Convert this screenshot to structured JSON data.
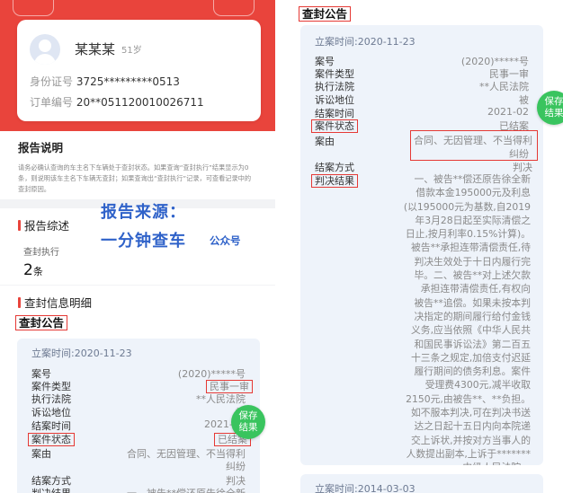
{
  "profile": {
    "name": "某某某",
    "age": "51岁",
    "id_label": "身份证号",
    "id_value": "3725*********0513",
    "order_label": "订单编号",
    "order_value": "20**051120010026711"
  },
  "explain": {
    "title": "报告说明",
    "text": "请务必确认查询的车主名下车辆处于查封状态。如果查询“查封执行”结果显示为0条，则说明该车主名下车辆无查封；如果查询出“查封执行”记录，可查看记录中的查封原因。"
  },
  "promo": {
    "line1": "报告来源：",
    "line2": "一分钟查车",
    "line3": "公众号"
  },
  "summary": {
    "title": "报告综述",
    "count_label": "查封执行",
    "count_value": "2",
    "count_unit": "条"
  },
  "detail": {
    "title": "查封信息明细",
    "seal_title": "查封公告"
  },
  "case": {
    "time_label": "立案时间:",
    "time": "2020-11-23",
    "fields": {
      "case_no": {
        "key": "案号",
        "value": "(2020)*****号"
      },
      "type": {
        "key": "案件类型",
        "value": "民事一审"
      },
      "court": {
        "key": "执行法院",
        "value": "**人民法院"
      },
      "position": {
        "key": "诉讼地位",
        "value": "被"
      },
      "close_time": {
        "key": "结案时间",
        "value": "2021-02"
      },
      "status": {
        "key": "案件状态",
        "value": "已结案"
      },
      "cause": {
        "key": "案由",
        "value_line1": "合同、无因管理、不当得利",
        "value_line2": "纠纷"
      },
      "close_method": {
        "key": "结案方式",
        "value": "判决"
      },
      "result": {
        "key": "判决结果"
      }
    },
    "result_lines": [
      "一、被告**偿还原告徐全新",
      "借款本金195000元及利息",
      "(以195000元为基数,自2019",
      "年3月28日起至实际清偿之",
      "日止,按月利率0.15%计算)。",
      "被告**承担连带清偿责任,待",
      "判决生效处于十日内履行完",
      "毕。二、被告**对上述欠款",
      "承担连带清偿责任,有权向",
      "被告**追偿。如果未按本判",
      "决指定的期间履行给付金钱",
      "义务,应当依照《中华人民共",
      "和国民事诉讼法》第二百五",
      "十三条之规定,加倍支付迟延",
      "履行期间的债务利息。案件",
      "受理费4300元,减半收取",
      "2150元,由被告**、**负担。",
      "如不服本判决,可在判决书送",
      "达之日起十五日内向本院递",
      "交上诉状,并按对方当事人的",
      "人数提出副本,上诉于*******",
      "中级人民法院。"
    ],
    "left_result_preview": "一、被告**偿还原告徐全新",
    "next_time": "2014-03-03"
  },
  "save_badge": {
    "line1": "保存",
    "line2": "结果"
  }
}
